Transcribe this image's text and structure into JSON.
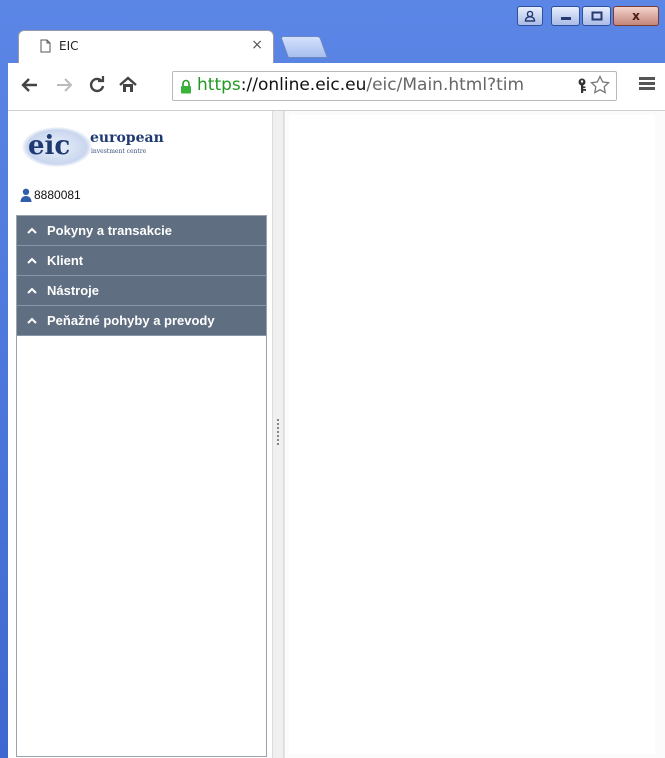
{
  "browser": {
    "tab_title": "EIC",
    "tab_close": "×",
    "address": {
      "scheme": "https",
      "host_part": "://online.eic.eu",
      "path": "/eic/Main.html?tim"
    },
    "icons": {
      "back": "arrow-left-icon",
      "forward": "arrow-right-icon",
      "reload": "reload-icon",
      "home": "home-icon",
      "lock": "lock-icon",
      "key": "key-icon",
      "star": "star-icon",
      "menu": "hamburger-menu-icon"
    }
  },
  "window_controls": {
    "user": "user-icon",
    "minimize": "minimize-icon",
    "maximize": "maximize-icon",
    "close_label": "x"
  },
  "app": {
    "logo": {
      "mark": "eic",
      "name": "european",
      "subtitle": "investment centre"
    },
    "user_id": "8880081",
    "nav": [
      {
        "label": "Pokyny a transakcie"
      },
      {
        "label": "Klient"
      },
      {
        "label": "Nástroje"
      },
      {
        "label": "Peňažné pohyby a prevody"
      }
    ],
    "colors": {
      "nav_background": "#5f6e80",
      "brand_navy": "#1f3a72",
      "url_green": "#1f9a1f"
    }
  }
}
